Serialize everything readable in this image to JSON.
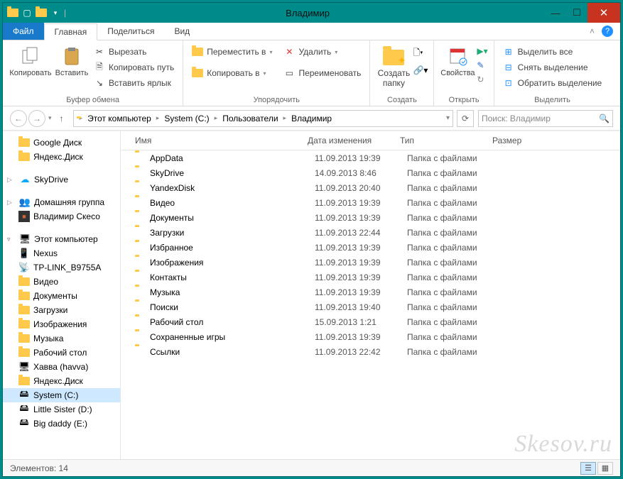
{
  "window": {
    "title": "Владимир"
  },
  "tabs": {
    "file": "Файл",
    "home": "Главная",
    "share": "Поделиться",
    "view": "Вид"
  },
  "ribbon": {
    "clipboard": {
      "copy": "Копировать",
      "paste": "Вставить",
      "cut": "Вырезать",
      "copy_path": "Копировать путь",
      "paste_shortcut": "Вставить ярлык",
      "group": "Буфер обмена"
    },
    "organize": {
      "move_to": "Переместить в",
      "copy_to": "Копировать в",
      "delete": "Удалить",
      "rename": "Переименовать",
      "group": "Упорядочить"
    },
    "new": {
      "new_folder_l1": "Создать",
      "new_folder_l2": "папку",
      "group": "Создать"
    },
    "open": {
      "properties": "Свойства",
      "group": "Открыть"
    },
    "select": {
      "select_all": "Выделить все",
      "select_none": "Снять выделение",
      "invert": "Обратить выделение",
      "group": "Выделить"
    }
  },
  "breadcrumb": [
    "Этот компьютер",
    "System (C:)",
    "Пользователи",
    "Владимир"
  ],
  "search_placeholder": "Поиск: Владимир",
  "sidebar": {
    "google_disk": "Google Диск",
    "yandex_disk": "Яндекс.Диск",
    "skydrive": "SkyDrive",
    "homegroup": "Домашняя группа",
    "user": "Владимир Скесо",
    "this_pc": "Этот компьютер",
    "nexus": "Nexus",
    "tplink": "TP-LINK_B9755A",
    "video": "Видео",
    "documents": "Документы",
    "downloads": "Загрузки",
    "pictures": "Изображения",
    "music": "Музыка",
    "desktop": "Рабочий стол",
    "havva": "Хавва (havva)",
    "yandex_disk2": "Яндекс.Диск",
    "system_c": "System (C:)",
    "little_sister": "Little Sister (D:)",
    "big_daddy": "Big daddy  (E:)"
  },
  "columns": {
    "name": "Имя",
    "date": "Дата изменения",
    "type": "Тип",
    "size": "Размер"
  },
  "files": [
    {
      "name": "AppData",
      "date": "11.09.2013 19:39",
      "type": "Папка с файлами"
    },
    {
      "name": "SkyDrive",
      "date": "14.09.2013 8:46",
      "type": "Папка с файлами"
    },
    {
      "name": "YandexDisk",
      "date": "11.09.2013 20:40",
      "type": "Папка с файлами"
    },
    {
      "name": "Видео",
      "date": "11.09.2013 19:39",
      "type": "Папка с файлами"
    },
    {
      "name": "Документы",
      "date": "11.09.2013 19:39",
      "type": "Папка с файлами"
    },
    {
      "name": "Загрузки",
      "date": "11.09.2013 22:44",
      "type": "Папка с файлами"
    },
    {
      "name": "Избранное",
      "date": "11.09.2013 19:39",
      "type": "Папка с файлами"
    },
    {
      "name": "Изображения",
      "date": "11.09.2013 19:39",
      "type": "Папка с файлами"
    },
    {
      "name": "Контакты",
      "date": "11.09.2013 19:39",
      "type": "Папка с файлами"
    },
    {
      "name": "Музыка",
      "date": "11.09.2013 19:39",
      "type": "Папка с файлами"
    },
    {
      "name": "Поиски",
      "date": "11.09.2013 19:40",
      "type": "Папка с файлами"
    },
    {
      "name": "Рабочий стол",
      "date": "15.09.2013 1:21",
      "type": "Папка с файлами"
    },
    {
      "name": "Сохраненные игры",
      "date": "11.09.2013 19:39",
      "type": "Папка с файлами"
    },
    {
      "name": "Ссылки",
      "date": "11.09.2013 22:42",
      "type": "Папка с файлами"
    }
  ],
  "status": {
    "count_label": "Элементов: 14"
  },
  "watermark": "Skesov.ru"
}
